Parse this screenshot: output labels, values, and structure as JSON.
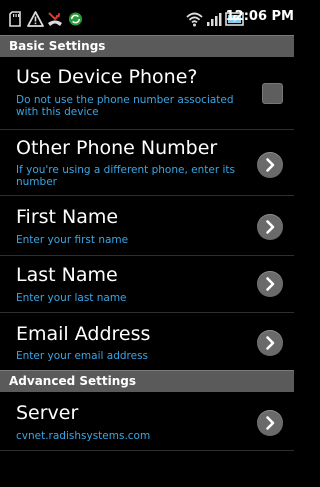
{
  "status_bar": {
    "time": "12:06 PM",
    "icons": [
      "sd-card-icon",
      "warning-icon",
      "missed-call-icon",
      "sync-icon",
      "wifi-icon",
      "signal-icon",
      "battery-icon"
    ]
  },
  "sections": {
    "basic": {
      "label": "Basic Settings"
    },
    "advanced": {
      "label": "Advanced Settings"
    }
  },
  "prefs": {
    "use_device_phone": {
      "title": "Use Device Phone?",
      "summary": "Do not use the phone number associated with this device",
      "checked": false
    },
    "other_phone": {
      "title": "Other Phone Number",
      "summary": "If you're using a different phone, enter its number"
    },
    "first_name": {
      "title": "First Name",
      "summary": "Enter your first name"
    },
    "last_name": {
      "title": "Last Name",
      "summary": "Enter your last name"
    },
    "email": {
      "title": "Email Address",
      "summary": "Enter your email address"
    },
    "server": {
      "title": "Server",
      "summary": "cvnet.radishsystems.com"
    }
  },
  "colors": {
    "summary_text": "#3aa6e6",
    "section_header_bg": "#5a5a5a",
    "background": "#000000"
  }
}
